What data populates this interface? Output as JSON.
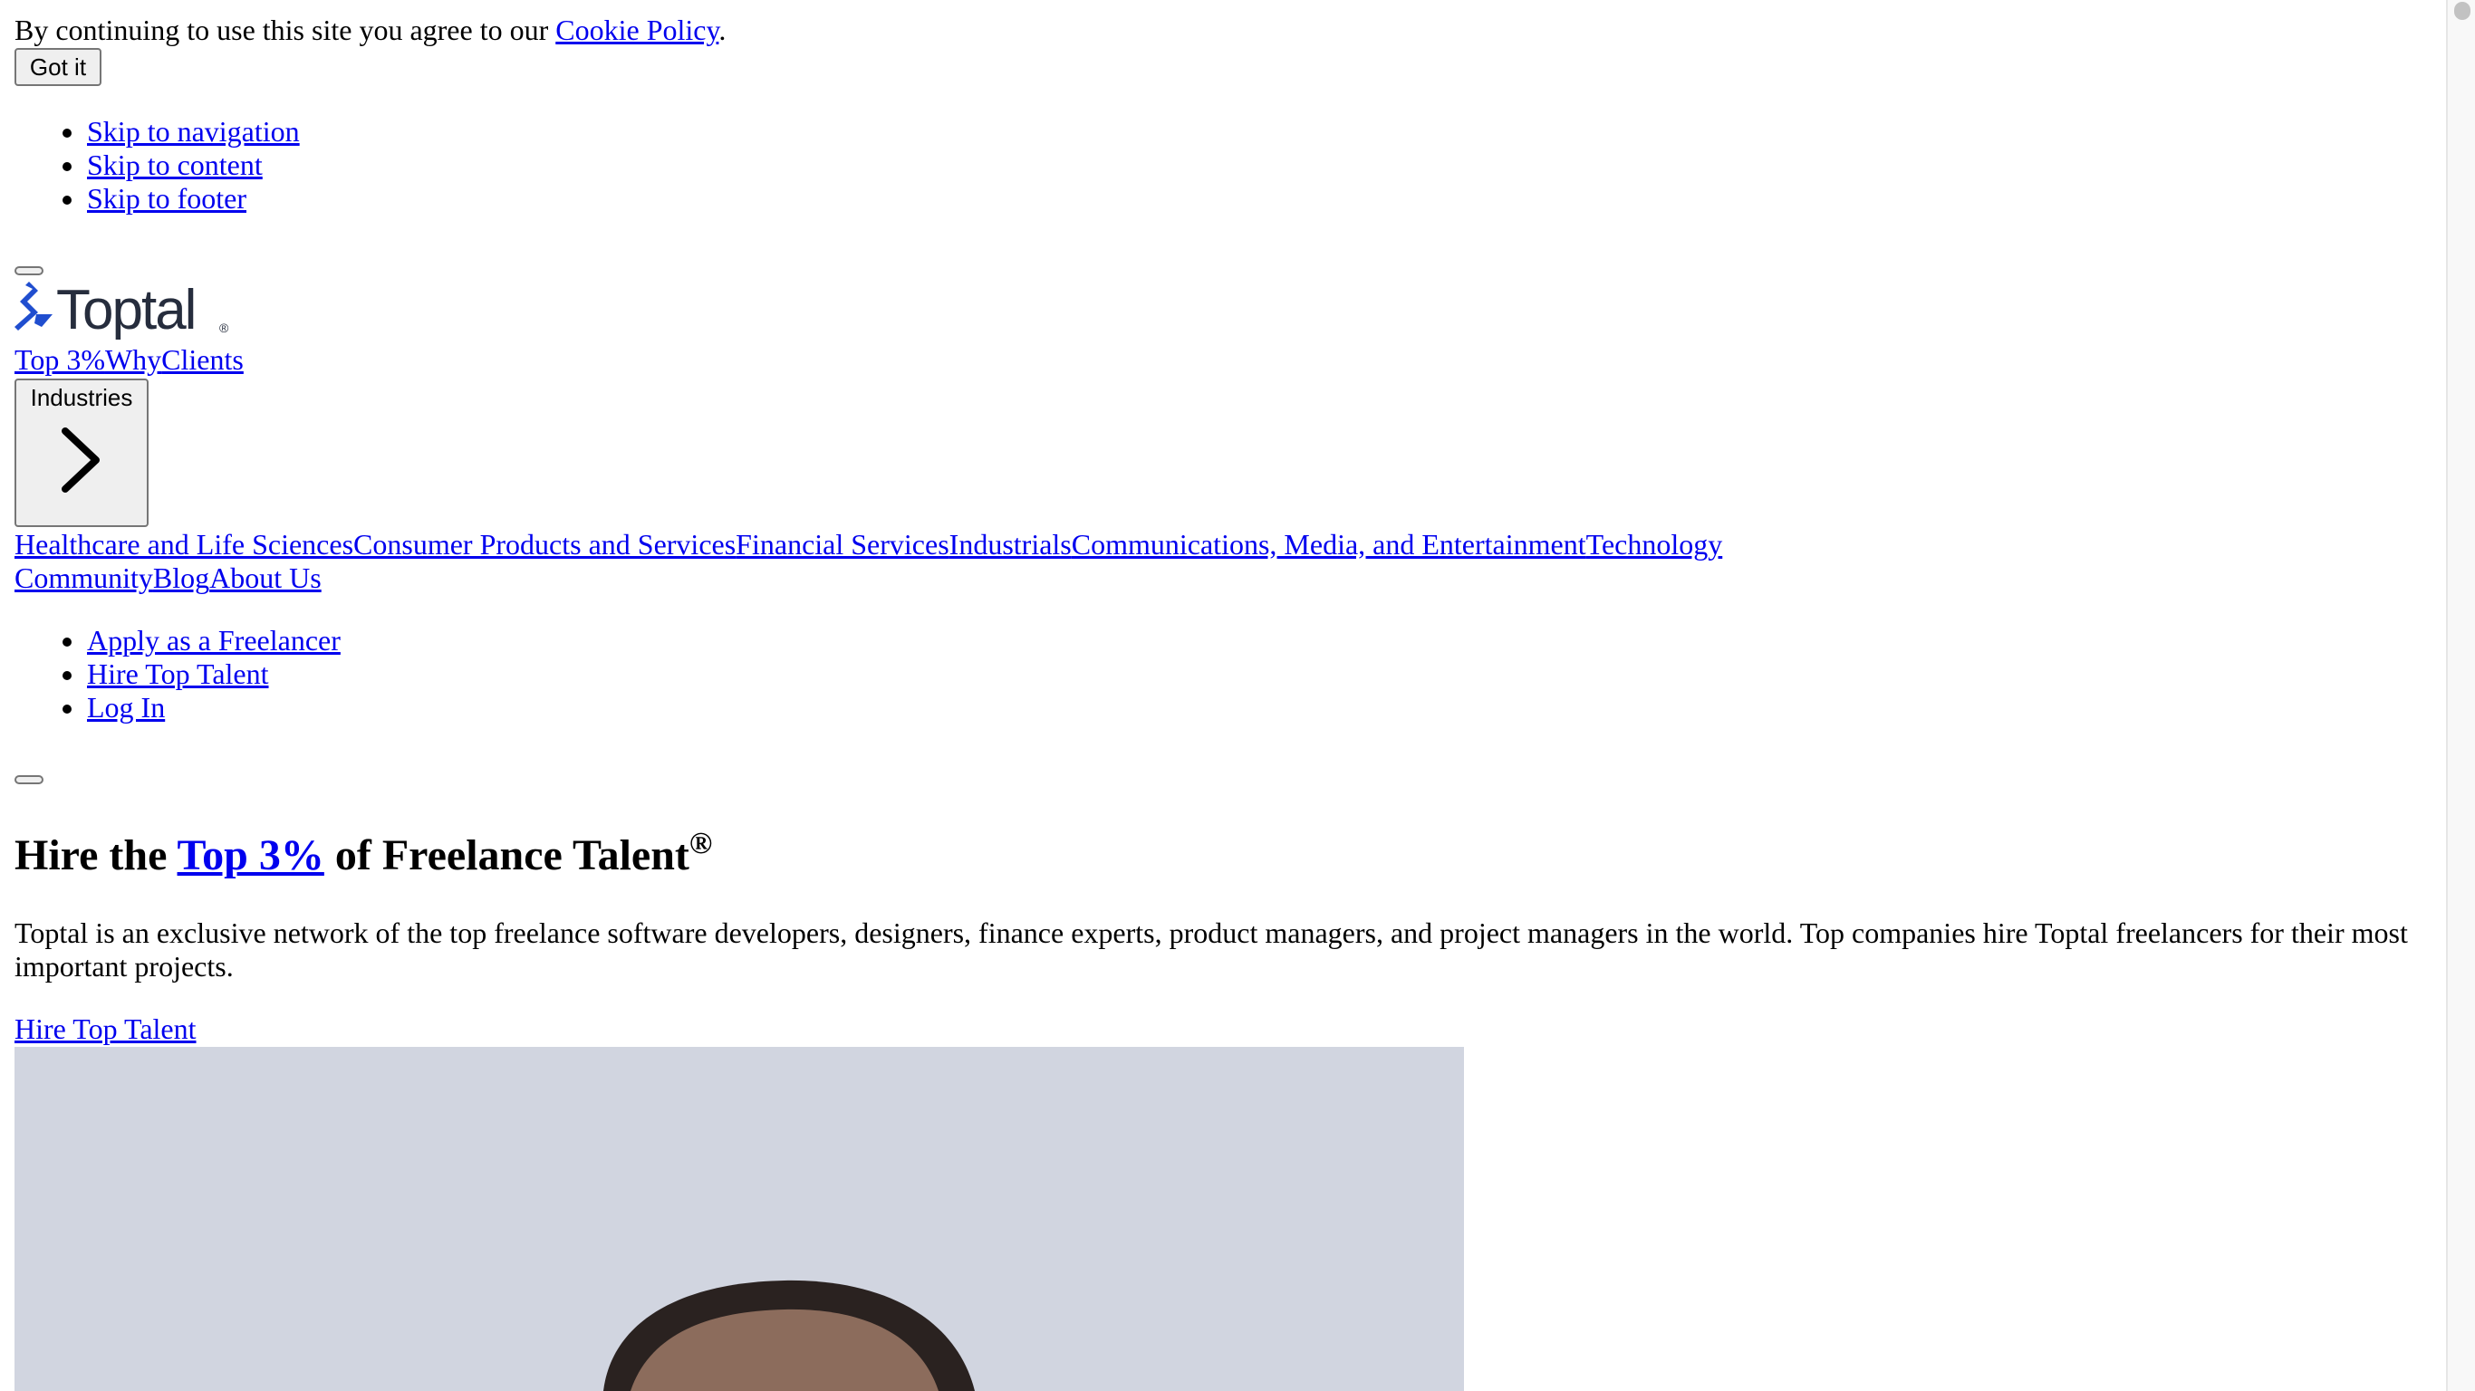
{
  "cookie_banner": {
    "text": "By continuing to use this site you agree to our ",
    "link_label": "Cookie Policy",
    "suffix": ".",
    "accept_label": "Got it"
  },
  "skip_links": [
    "Skip to navigation",
    "Skip to content",
    "Skip to footer"
  ],
  "brand": {
    "logo_text": "Toptal",
    "registered_mark": "®",
    "accent_color": "#204ecf",
    "text_color": "#262d3d"
  },
  "primary_nav": [
    "Top 3%",
    "Why",
    "Clients"
  ],
  "industries_menu": {
    "label": "Industries",
    "icon": "chevron-right-icon",
    "items": [
      "Healthcare and Life Sciences",
      "Consumer Products and Services",
      "Financial Services",
      "Industrials",
      "Communications, Media, and Entertainment",
      "Technology"
    ]
  },
  "secondary_nav": [
    "Community",
    "Blog",
    "About Us"
  ],
  "account_links": [
    "Apply as a Freelancer",
    "Hire Top Talent",
    "Log In"
  ],
  "hero": {
    "title_before": "Hire the ",
    "title_link": "Top 3%",
    "title_after": " of Freelance Talent",
    "title_mark": "®",
    "description": "Toptal is an exclusive network of the top freelance software developers, designers, finance experts, product managers, and project managers in the world. Top companies hire Toptal freelancers for their most important projects.",
    "cta_label": "Hire Top Talent",
    "image_background": "#d1d5e0"
  },
  "colors": {
    "link": "#0000ee",
    "button_bg": "#efefef",
    "button_border": "#767676"
  }
}
